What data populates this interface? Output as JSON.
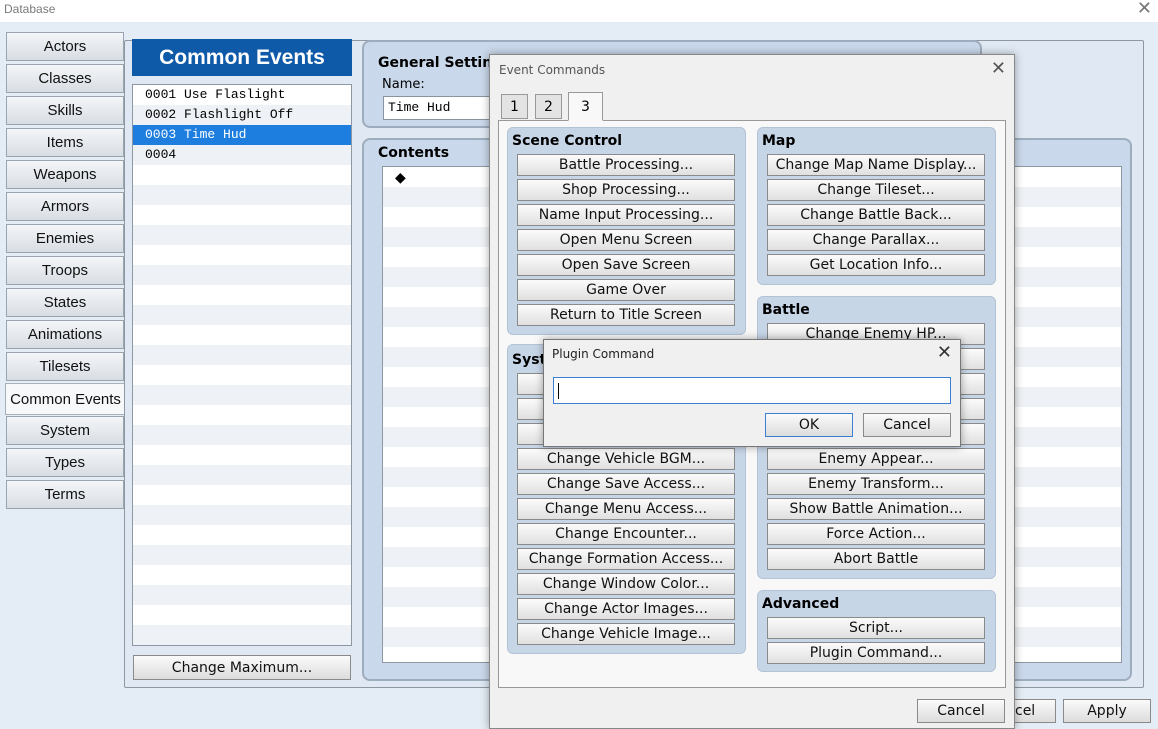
{
  "window": {
    "title": "Database",
    "close_glyph": "✕"
  },
  "sidebar": {
    "items": [
      {
        "label": "Actors"
      },
      {
        "label": "Classes"
      },
      {
        "label": "Skills"
      },
      {
        "label": "Items"
      },
      {
        "label": "Weapons"
      },
      {
        "label": "Armors"
      },
      {
        "label": "Enemies"
      },
      {
        "label": "Troops"
      },
      {
        "label": "States"
      },
      {
        "label": "Animations"
      },
      {
        "label": "Tilesets"
      },
      {
        "label": "Common Events"
      },
      {
        "label": "System"
      },
      {
        "label": "Types"
      },
      {
        "label": "Terms"
      }
    ],
    "active": "Common Events"
  },
  "common_events": {
    "header": "Common Events",
    "items": [
      "0001 Use Flaslight",
      "0002 Flashlight Off",
      "0003 Time Hud",
      "0004"
    ],
    "selected": "0003 Time Hud",
    "change_maximum": "Change Maximum..."
  },
  "general": {
    "title": "General Setting",
    "name_label": "Name:",
    "name_value": "Time Hud",
    "contents_title": "Contents",
    "contents_first_row": "◆"
  },
  "footer": {
    "cancel_partial": "cel",
    "apply": "Apply"
  },
  "event_commands": {
    "title": "Event Commands",
    "close_glyph": "✕",
    "tabs": [
      "1",
      "2",
      "3"
    ],
    "active_tab": "3",
    "scene_control": {
      "title": "Scene Control",
      "buttons": [
        "Battle Processing...",
        "Shop Processing...",
        "Name Input Processing...",
        "Open Menu Screen",
        "Open Save Screen",
        "Game Over",
        "Return to Title Screen"
      ]
    },
    "system": {
      "title_partial": "Syst",
      "buttons": [
        "Change Vehicle BGM...",
        "Change Save Access...",
        "Change Menu Access...",
        "Change Encounter...",
        "Change Formation Access...",
        "Change Window Color...",
        "Change Actor Images...",
        "Change Vehicle Image..."
      ]
    },
    "map": {
      "title": "Map",
      "buttons": [
        "Change Map Name Display...",
        "Change Tileset...",
        "Change Battle Back...",
        "Change Parallax...",
        "Get Location Info..."
      ]
    },
    "battle": {
      "title": "Battle",
      "partial_button": "Change Enemy HP...",
      "buttons": [
        "Enemy Appear...",
        "Enemy Transform...",
        "Show Battle Animation...",
        "Force Action...",
        "Abort Battle"
      ]
    },
    "advanced": {
      "title": "Advanced",
      "buttons": [
        "Script...",
        "Plugin Command..."
      ]
    },
    "cancel": "Cancel"
  },
  "plugin_command": {
    "title": "Plugin Command",
    "close_glyph": "✕",
    "input_value": "",
    "ok": "OK",
    "cancel": "Cancel"
  }
}
